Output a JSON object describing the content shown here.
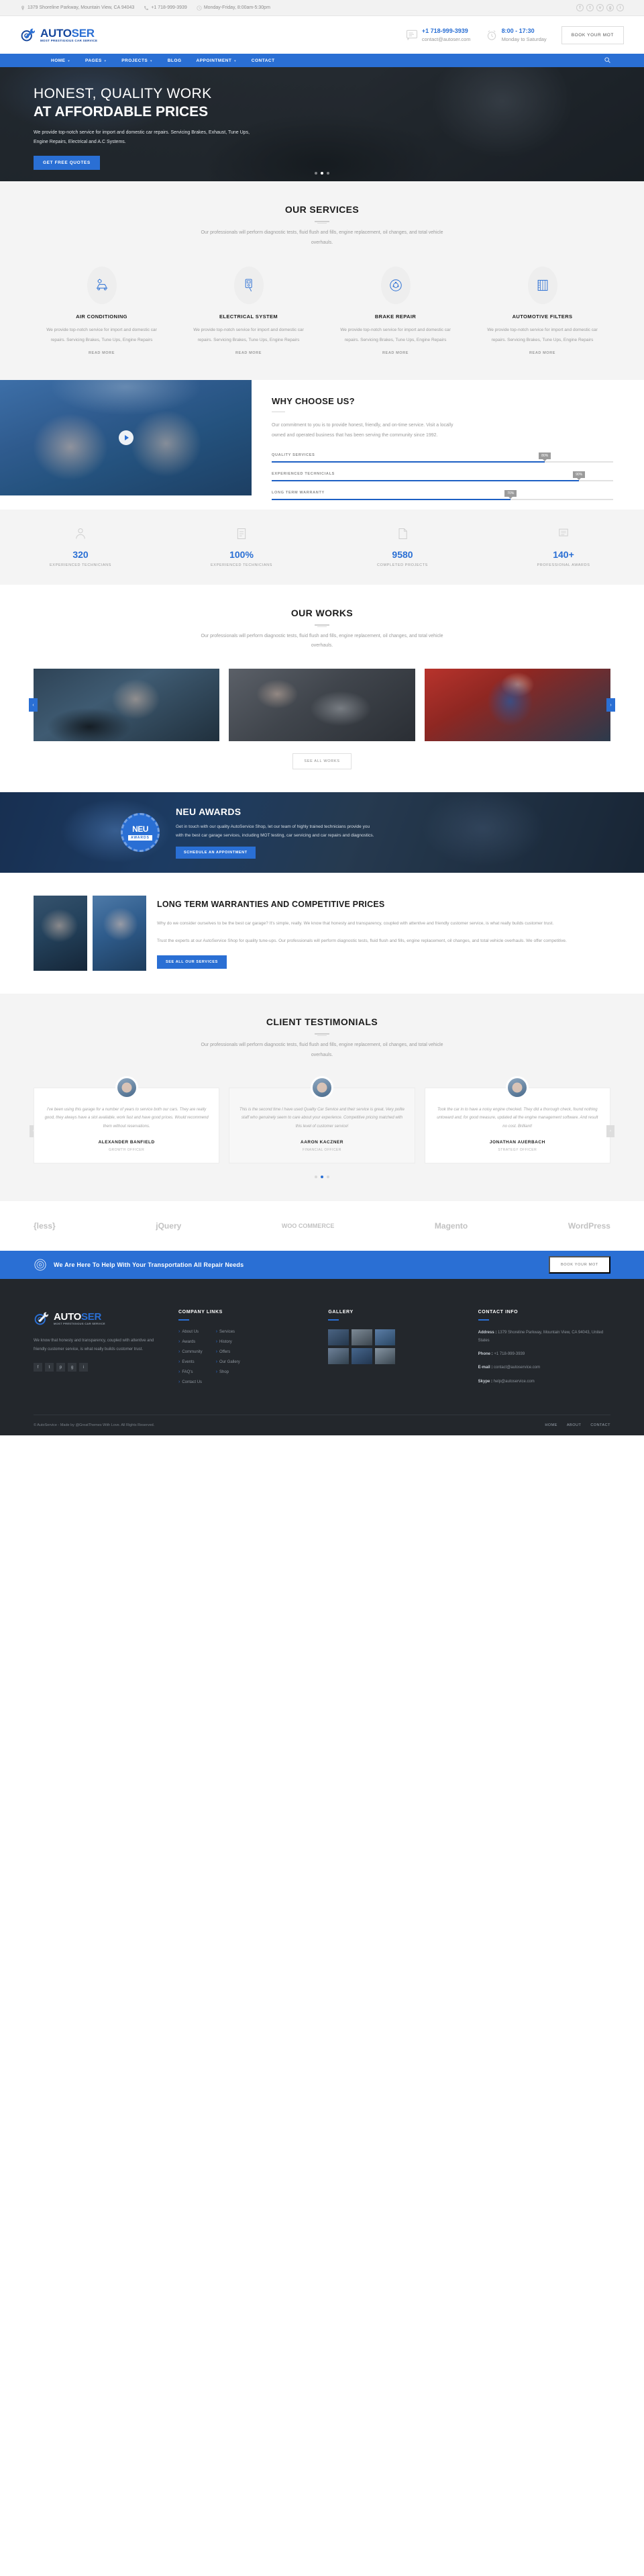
{
  "topbar": {
    "address": "1379 Shoreline Parkway, Mountain View, CA 94043",
    "phone": "+1 718-999-3939",
    "hours": "Monday-Friday, 8:00am-5:30pm",
    "address_icon": "location-pin-icon",
    "phone_icon": "phone-icon",
    "clock_icon": "clock-icon",
    "social": [
      {
        "name": "facebook-icon",
        "glyph": "f"
      },
      {
        "name": "twitter-icon",
        "glyph": "t"
      },
      {
        "name": "vimeo-icon",
        "glyph": "v"
      },
      {
        "name": "google-plus-icon",
        "glyph": "g"
      },
      {
        "name": "instagram-icon",
        "glyph": "i"
      }
    ]
  },
  "header": {
    "logo_primary": "AUTO",
    "logo_secondary": "SER",
    "logo_tagline": "MOST PRESTIGIOUS CAR SERVICE",
    "phone": "+1 718-999-3939",
    "email": "contact@autoser.com",
    "hours_time": "8:00 - 17:30",
    "hours_days": "Monday to Saturday",
    "book_label": "BOOK YOUR MOT"
  },
  "nav": {
    "items": [
      {
        "label": "HOME",
        "has_dropdown": true
      },
      {
        "label": "PAGES",
        "has_dropdown": true
      },
      {
        "label": "PROJECTS",
        "has_dropdown": true
      },
      {
        "label": "BLOG",
        "has_dropdown": false
      },
      {
        "label": "APPOINTMENT",
        "has_dropdown": true
      },
      {
        "label": "CONTACT",
        "has_dropdown": false
      }
    ],
    "search_icon": "search-icon"
  },
  "hero": {
    "title_line1": "HONEST, QUALITY WORK",
    "title_line2": "AT AFFORDABLE PRICES",
    "paragraph": "We provide top-notch service for import and domestic car repairs. Servicing Brakes, Exhaust, Tune Ups, Engine Repairs, Electrical and A.C Systems.",
    "cta_label": "GET FREE QUOTES",
    "slides": 3,
    "active_slide": 1
  },
  "services": {
    "title": "OUR SERVICES",
    "subtitle": "Our professionals will perform diagnostic tests, fluid flush and fills, engine replacement, oil changes, and total vehicle overhauls.",
    "read_more": "READ MORE",
    "items": [
      {
        "title": "AIR CONDITIONING",
        "icon": "car-ac-icon",
        "desc": "We provide top-notch service for import and domestic car repairs. Servicing Brakes, Tune Ups, Engine Repairs"
      },
      {
        "title": "ELECTRICAL SYSTEM",
        "icon": "multimeter-icon",
        "desc": "We provide top-notch service for import and domestic car repairs. Servicing Brakes, Tune Ups, Engine Repairs"
      },
      {
        "title": "BRAKE REPAIR",
        "icon": "brake-disc-icon",
        "desc": "We provide top-notch service for import and domestic car repairs. Servicing Brakes, Tune Ups, Engine Repairs"
      },
      {
        "title": "AUTOMOTIVE FILTERS",
        "icon": "air-filter-icon",
        "desc": "We provide top-notch service for import and domestic car repairs. Servicing Brakes, Tune Ups, Engine Repairs"
      }
    ]
  },
  "why": {
    "title": "WHY CHOOSE US?",
    "paragraph": "Our commitment to you is to provide honest, friendly, and on-time service. Visit a locally owned and operated business that has been serving the community since 1992.",
    "play_icon": "play-button-icon",
    "bars": [
      {
        "label": "QUALITY SERVICES",
        "pct": 80,
        "pct_label": "80%"
      },
      {
        "label": "EXPERIENCED TECHNICIALS",
        "pct": 90,
        "pct_label": "90%"
      },
      {
        "label": "LONG TERM WARRANTY",
        "pct": 70,
        "pct_label": "70%"
      }
    ]
  },
  "counters": [
    {
      "value": "320",
      "label": "EXPERIENCED TECHNICIANS",
      "icon": "technician-icon"
    },
    {
      "value": "100%",
      "label": "EXPERIENCED TECHNICIANS",
      "icon": "checklist-icon"
    },
    {
      "value": "9580",
      "label": "COMPLETED PROJECTS",
      "icon": "project-icon"
    },
    {
      "value": "140+",
      "label": "PROFESSIONAL AWARDS",
      "icon": "award-icon"
    }
  ],
  "works": {
    "title": "OUR WORKS",
    "subtitle": "Our professionals will perform diagnostic tests, fluid flush and fills, engine replacement, oil changes, and total vehicle overhauls.",
    "button": "SEE ALL WORKS",
    "prev_icon": "chevron-left-icon",
    "next_icon": "chevron-right-icon",
    "items": [
      {
        "name": "mechanic-under-hood"
      },
      {
        "name": "laptop-diagnostics"
      },
      {
        "name": "mechanic-red-car"
      }
    ]
  },
  "awards": {
    "badge_top": "NEU",
    "badge_bottom": "AWARDS",
    "title": "NEU AWARDS",
    "paragraph": "Get in touch with our quality AutoService Shop, let our team of highly trained technicians provide you with the best car garage services, including MOT testing, car servicing and car repairs and diagnostics.",
    "cta_label": "SCHEDULE AN APPOINTMENT"
  },
  "warranties": {
    "title": "LONG TERM WARRANTIES AND COMPETITIVE PRICES",
    "paragraph1": "Why do we consider ourselves to be the best car garage? It's simple, really. We know that honesty and transparency, coupled with attentive and friendly customer service, is what really builds customer trust.",
    "paragraph2": "Trust the experts at our AutoService Shop for quality tune-ups. Our professionals will perform diagnostic tests, fluid flush and fills, engine replacement, oil changes, and total vehicle overhauls. We offer competitive.",
    "cta_label": "SEE ALL OUR SERVICES"
  },
  "testimonials": {
    "title": "CLIENT TESTIMONIALS",
    "subtitle": "Our professionals will perform diagnostic tests, fluid flush and fills, engine replacement, oil changes, and total vehicle overhauls.",
    "prev_icon": "chevron-left-icon",
    "next_icon": "chevron-right-icon",
    "active_dot": 2,
    "items": [
      {
        "quote": "I've been using this garage for a number of years to service both our cars. They are really good, they always have a slot available, work fast and have good prices. Would recommend them without reservations.",
        "name": "ALEXANDER BANFIELD",
        "role": "GROWTH OFFICER"
      },
      {
        "quote": "This is the second time I have used Quality Car Service and their service is great. Very polite staff who genuinely seem to care about your experience. Competitive pricing matched with this level of customer service!",
        "name": "AARON KACZNER",
        "role": "FINANCIAL OFFICER"
      },
      {
        "quote": "Took the car in to have a noisy engine checked. They did a thorough check, found nothing untoward and, for good measure, updated all the engine management software. And result no cost. Brilliant!",
        "name": "JONATHAN AUERBACH",
        "role": "STRATEGY OFFICER"
      }
    ]
  },
  "brands": [
    {
      "label": "{less}",
      "name": "less-logo"
    },
    {
      "label": "jQuery",
      "name": "jquery-logo"
    },
    {
      "label": "WOO COMMERCE",
      "name": "woocommerce-logo"
    },
    {
      "label": "Magento",
      "name": "magento-logo"
    },
    {
      "label": "WordPress",
      "name": "wordpress-logo"
    }
  ],
  "cta": {
    "icon": "gear-circle-icon",
    "text": "We Are Here To Help With Your Transportation All Repair Needs",
    "button": "BOOK YOUR MOT"
  },
  "footer": {
    "logo_primary": "AUTO",
    "logo_secondary": "SER",
    "logo_tagline": "MOST PRESTIGIOUS CAR SERVICE",
    "about": "We know that honesty and transparency, coupled with attentive and friendly customer service, is what really builds customer trust.",
    "social": [
      {
        "name": "facebook-icon",
        "glyph": "f"
      },
      {
        "name": "twitter-icon",
        "glyph": "t"
      },
      {
        "name": "pinterest-icon",
        "glyph": "p"
      },
      {
        "name": "google-plus-icon",
        "glyph": "g"
      },
      {
        "name": "instagram-icon",
        "glyph": "i"
      }
    ],
    "links_title": "COMPANY LINKS",
    "links_col1": [
      "About Us",
      "Awards",
      "Community",
      "Events",
      "FAQ's",
      "Contact Us"
    ],
    "links_col2": [
      "Services",
      "History",
      "Offers",
      "Our Gallery",
      "Shop"
    ],
    "gallery_title": "GALLERY",
    "gallery_count": 6,
    "contact_title": "CONTACT INFO",
    "contact_address_label": "Address :",
    "contact_address": "1379 Shoreline Parkway, Mountain View, CA 94043, United States",
    "contact_phone_label": "Phone :",
    "contact_phone": "+1 718-999-3939",
    "contact_email_label": "E-mail :",
    "contact_email": "contact@autoservice.com",
    "contact_skype_label": "Skype :",
    "contact_skype": "help@autoservice.com",
    "copyright": "© AutoService - Made by @GreatThemes With Love. All Rights Reserved.",
    "bottom_nav": [
      "HOME",
      "ABOUT",
      "CONTACT"
    ]
  }
}
